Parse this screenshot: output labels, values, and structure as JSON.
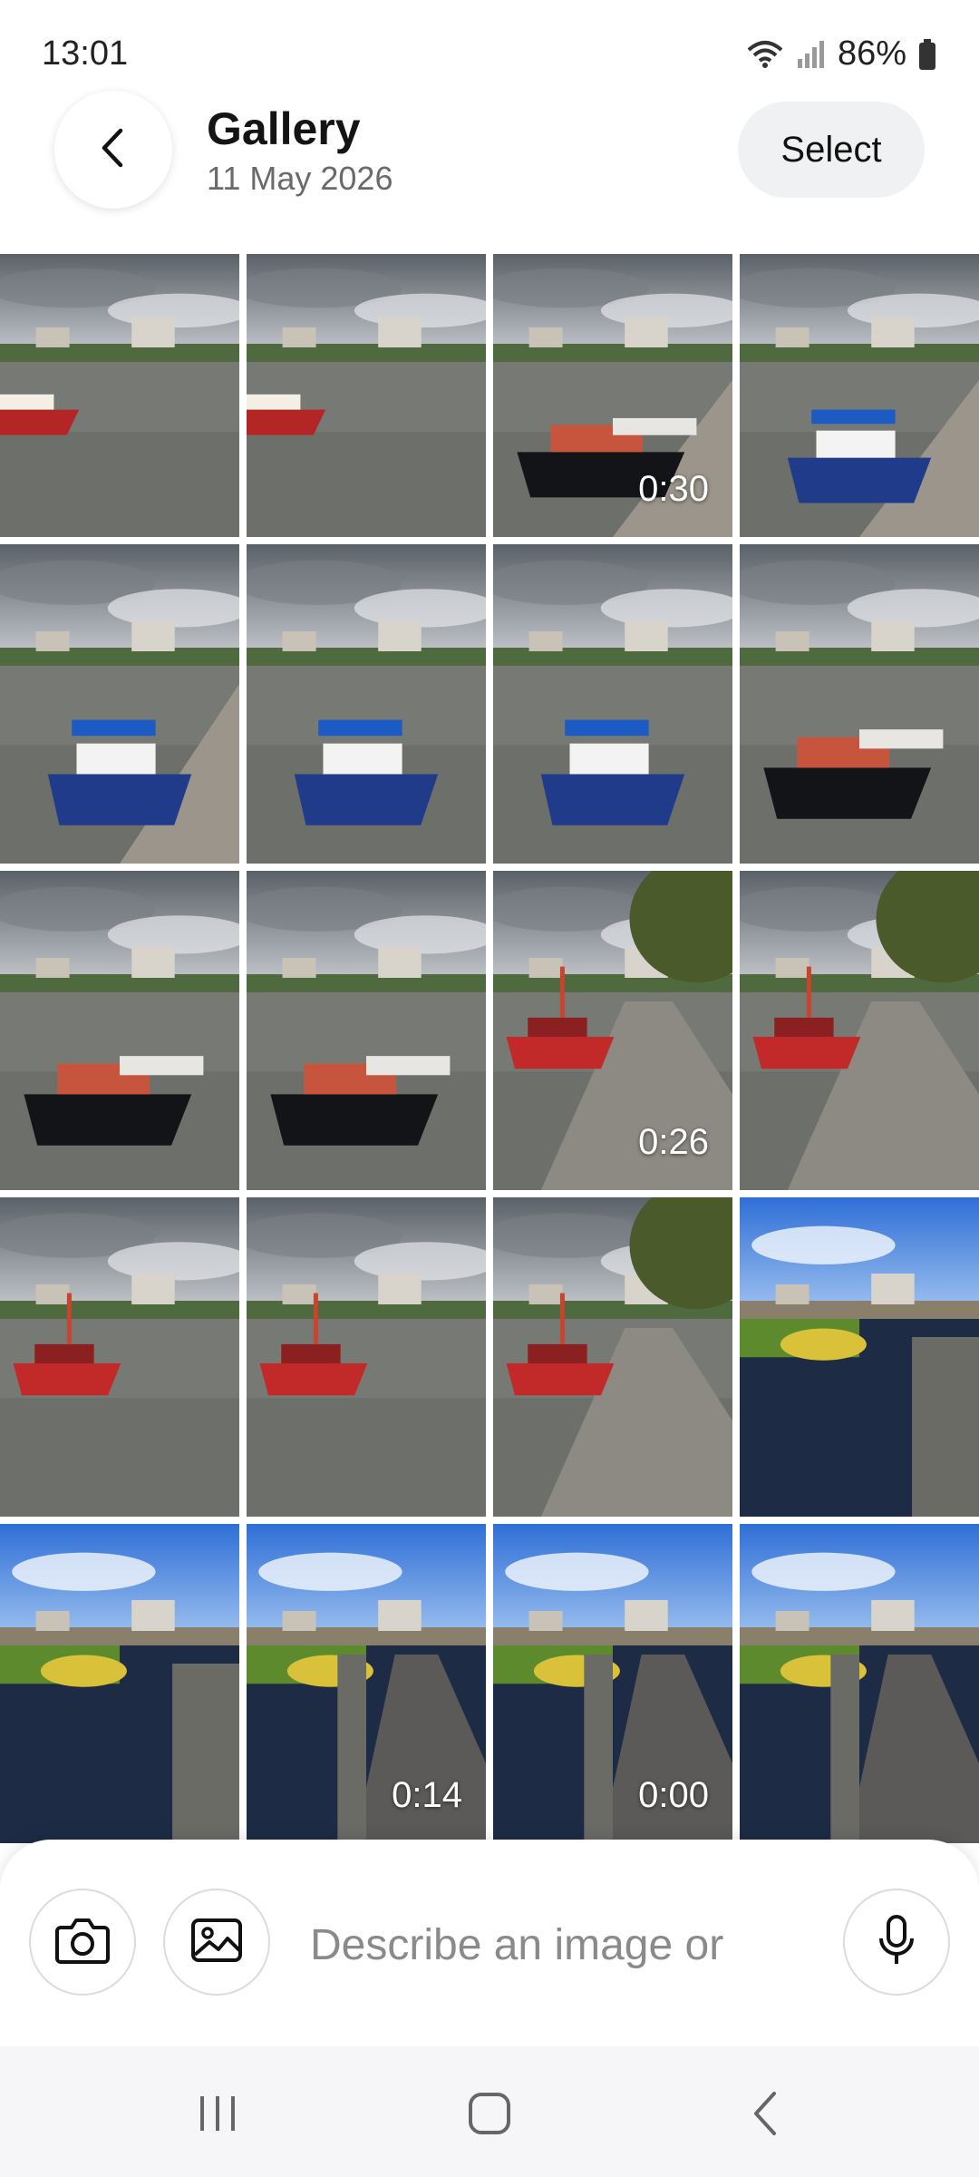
{
  "status": {
    "time": "13:01",
    "battery": "86%",
    "icons": [
      "wifi-icon",
      "signal-icon",
      "battery-icon"
    ]
  },
  "header": {
    "back_icon": "chevron-left-icon",
    "title": "Gallery",
    "date": "11 May 2026",
    "select_label": "Select"
  },
  "grid": {
    "columns": 4,
    "tiles": [
      {
        "scene": "harbour-ferry",
        "duration": ""
      },
      {
        "scene": "harbour-ferry",
        "duration": ""
      },
      {
        "scene": "barge-dock",
        "duration": "0:30"
      },
      {
        "scene": "blue-boat-dock",
        "duration": ""
      },
      {
        "scene": "blue-boat-dock",
        "duration": ""
      },
      {
        "scene": "harbour-blue-boat",
        "duration": ""
      },
      {
        "scene": "harbour-blue-boat",
        "duration": ""
      },
      {
        "scene": "barge-harbour",
        "duration": ""
      },
      {
        "scene": "barge-harbour",
        "duration": ""
      },
      {
        "scene": "barge-harbour",
        "duration": ""
      },
      {
        "scene": "red-boat-path",
        "duration": "0:26"
      },
      {
        "scene": "red-boat-path",
        "duration": ""
      },
      {
        "scene": "red-boat-water",
        "duration": ""
      },
      {
        "scene": "red-boat-water",
        "duration": ""
      },
      {
        "scene": "red-boat-path",
        "duration": ""
      },
      {
        "scene": "village-river",
        "duration": ""
      },
      {
        "scene": "village-river",
        "duration": ""
      },
      {
        "scene": "village-lane",
        "duration": "0:14"
      },
      {
        "scene": "village-lane",
        "duration": "0:00"
      },
      {
        "scene": "village-lane",
        "duration": ""
      }
    ]
  },
  "prompt": {
    "camera_icon": "camera-icon",
    "gallery_icon": "image-icon",
    "placeholder": "Describe an image or",
    "mic_icon": "microphone-icon"
  },
  "nav": {
    "recents_icon": "recent-apps-icon",
    "home_icon": "home-icon",
    "back_icon": "back-icon"
  },
  "colors": {
    "accent_bg": "#f0f1f3",
    "nav_bg": "#f6f6f8"
  }
}
